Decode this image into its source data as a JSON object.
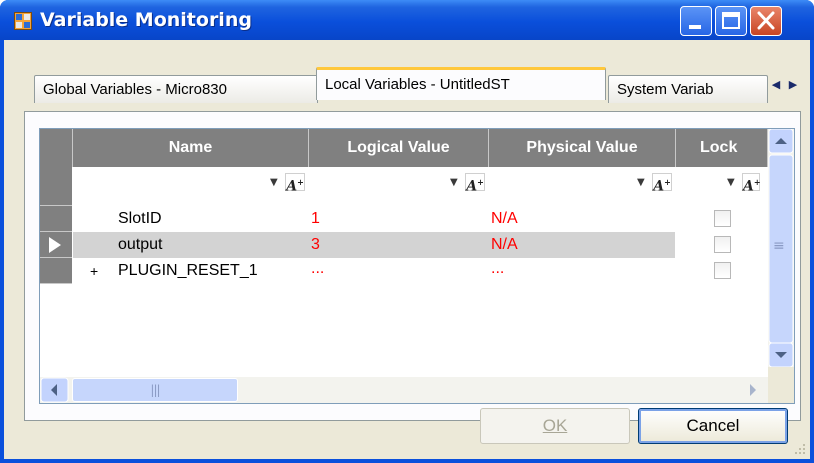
{
  "window": {
    "title": "Variable Monitoring"
  },
  "tabs": [
    {
      "label": "Global Variables - Micro830"
    },
    {
      "label": "Local Variables - UntitledST"
    },
    {
      "label": "System Variab"
    }
  ],
  "grid": {
    "columns": [
      "Name",
      "Logical Value",
      "Physical Value",
      "Lock"
    ],
    "rows": [
      {
        "name": "SlotID",
        "logical": "1",
        "physical": "N/A"
      },
      {
        "name": "output",
        "logical": "3",
        "physical": "N/A"
      },
      {
        "name": "PLUGIN_RESET_1",
        "logical": "...",
        "physical": "..."
      }
    ],
    "new_row_marker": "+",
    "hscroll_grip": "|||",
    "vscroll_grip": "≡"
  },
  "buttons": {
    "ok_label": "OK",
    "cancel_label": "Cancel"
  },
  "colors": {
    "title_blue": "#0a50dc",
    "header_gray": "#808080",
    "value_red": "#ff0000",
    "client_bg": "#ece9d8"
  },
  "icons": [
    "window-app-icon",
    "minimize-icon",
    "maximize-icon",
    "close-icon",
    "tab-scroll-left-icon",
    "tab-scroll-right-icon",
    "row-selector-icon",
    "filter-dropdown-icon",
    "filter-font-icon",
    "scroll-up-icon",
    "scroll-down-icon",
    "scroll-left-icon",
    "scroll-right-icon",
    "resize-grip-icon"
  ]
}
